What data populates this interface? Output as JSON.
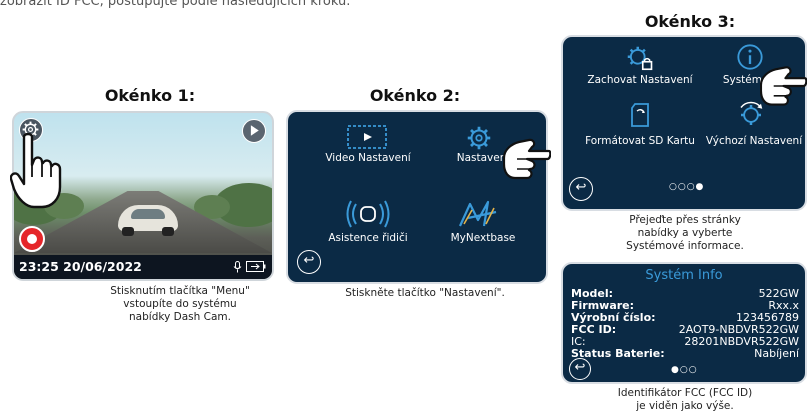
{
  "intro_text": "zobrazit ID FCC, postupujte podle následujících kroků.",
  "panel1": {
    "title": "Okénko 1:",
    "timestamp": "23:25 20/06/2022",
    "caption": [
      "Stisknutím tlačítka \"Menu\"",
      "vstoupíte do systému",
      "nabídky Dash Cam."
    ],
    "icons": [
      "gear-icon",
      "play-icon",
      "record-icon",
      "microphone-icon",
      "battery-icon"
    ]
  },
  "panel2": {
    "title": "Okénko 2:",
    "items": [
      "Video Nastavení",
      "Nastavení",
      "Asistence řidiči",
      "MyNextbase"
    ],
    "caption": "Stiskněte tlačítko \"Nastavení\"."
  },
  "panel3": {
    "title": "Okénko 3:",
    "items": [
      "Zachovat Nastavení",
      "Systém Info",
      "Formátovat SD Kartu",
      "Výchozí Nastavení"
    ],
    "dots": "○○○●",
    "caption": [
      "Přejeďte přes stránky",
      "nabídky a vyberte",
      "Systémové informace."
    ]
  },
  "panel4": {
    "title": "Systém Info",
    "rows": [
      {
        "key": "Model:",
        "value": "522GW"
      },
      {
        "key": "Firmware:",
        "value": "Rxx.x"
      },
      {
        "key": "Výrobní číslo:",
        "value": "123456789"
      },
      {
        "key": "FCC ID:",
        "value": "2AOT9-NBDVR522GW"
      },
      {
        "key": "IC:",
        "value": "28201NBDVR522GW"
      },
      {
        "key": "Status Baterie:",
        "value": "Nabíjení"
      }
    ],
    "dots": "●○○",
    "caption": [
      "Identifikátor FCC (FCC ID)",
      "je viděn jako výše."
    ]
  },
  "colors": {
    "navy": "#0b2a45",
    "accent_blue": "#3a9ad9",
    "record_red": "#e5262a"
  }
}
